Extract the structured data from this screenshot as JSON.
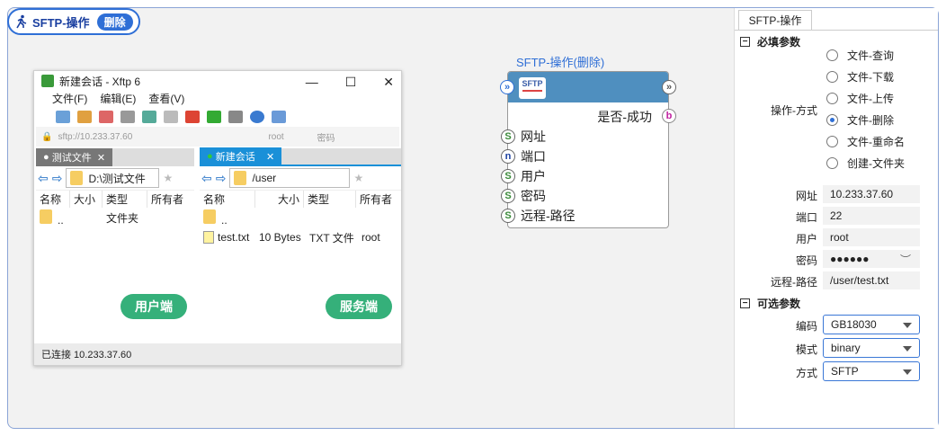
{
  "header": {
    "title": "SFTP-操作",
    "badge": "删除"
  },
  "xftp": {
    "window_title": "新建会话   - Xftp 6",
    "menu": [
      "文件(F)",
      "编辑(E)",
      "查看(V)"
    ],
    "address": "sftp://10.233.37.60",
    "address_user": "root",
    "address_pass": "密码",
    "left_tab": "测试文件",
    "right_tab": "新建会话",
    "left_path": "D:\\测试文件",
    "right_path": "/user",
    "left_cols": [
      "名称",
      "大小",
      "类型",
      "所有者"
    ],
    "right_cols": [
      "名称",
      "大小",
      "类型",
      "所有者"
    ],
    "left_rows": [
      {
        "name": "..",
        "type": "文件夹"
      }
    ],
    "right_rows": [
      {
        "name": ".."
      },
      {
        "name": "test.txt",
        "size": "10 Bytes",
        "type": "TXT 文件",
        "owner": "root"
      }
    ],
    "left_pill": "用户端",
    "right_pill": "服务端",
    "status": "已连接 10.233.37.60"
  },
  "node": {
    "title": "SFTP-操作(删除)",
    "icon_text": "SFTP",
    "output_label": "是否-成功",
    "output_port": "b",
    "inputs": [
      {
        "port": "S",
        "label": "网址"
      },
      {
        "port": "n",
        "label": "端口"
      },
      {
        "port": "S",
        "label": "用户"
      },
      {
        "port": "S",
        "label": "密码"
      },
      {
        "port": "S",
        "label": "远程-路径"
      }
    ]
  },
  "panel": {
    "tab": "SFTP-操作",
    "required_section": "必填参数",
    "optional_section": "可选参数",
    "op_label": "操作-方式",
    "ops": [
      "文件-查询",
      "文件-下载",
      "文件-上传",
      "文件-删除",
      "文件-重命名",
      "创建-文件夹"
    ],
    "op_selected": 3,
    "fields": [
      {
        "label": "网址",
        "value": "10.233.37.60"
      },
      {
        "label": "端口",
        "value": "22"
      },
      {
        "label": "用户",
        "value": "root"
      },
      {
        "label": "密码",
        "value": "●●●●●●"
      },
      {
        "label": "远程-路径",
        "value": "/user/test.txt"
      }
    ],
    "selects": [
      {
        "label": "编码",
        "value": "GB18030"
      },
      {
        "label": "模式",
        "value": "binary"
      },
      {
        "label": "方式",
        "value": "SFTP"
      }
    ]
  }
}
